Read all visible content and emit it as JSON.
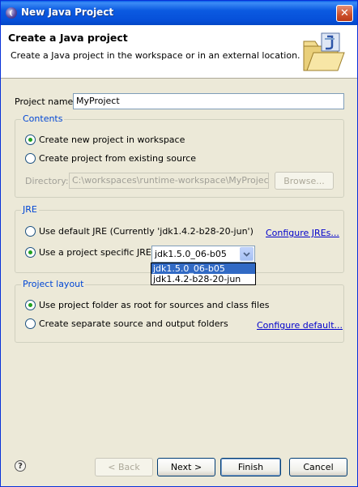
{
  "window": {
    "title": "New Java Project"
  },
  "header": {
    "title": "Create a Java project",
    "description": "Create a Java project in the workspace or in an external location."
  },
  "project_name": {
    "label": "Project name:",
    "value": "MyProject"
  },
  "contents": {
    "title": "Contents",
    "option_new": "Create new project in workspace",
    "option_existing": "Create project from existing source",
    "directory_label": "Directory:",
    "directory_value": "C:\\workspaces\\runtime-workspace\\MyProject",
    "browse_label": "Browse..."
  },
  "jre": {
    "title": "JRE",
    "option_default": "Use default JRE (Currently 'jdk1.4.2-b28-20-jun')",
    "configure_link": "Configure JREs...",
    "option_specific": "Use a project specific JRE:",
    "selected": "jdk1.5.0_06-b05",
    "options": [
      "jdk1.5.0_06-b05",
      "jdk1.4.2-b28-20-jun"
    ]
  },
  "layout": {
    "title": "Project layout",
    "option_root": "Use project folder as root for sources and class files",
    "option_separate": "Create separate source and output folders",
    "configure_link": "Configure default..."
  },
  "buttons": {
    "back": "< Back",
    "next": "Next >",
    "finish": "Finish",
    "cancel": "Cancel"
  },
  "icons": {
    "help": "?",
    "close": "✕"
  }
}
